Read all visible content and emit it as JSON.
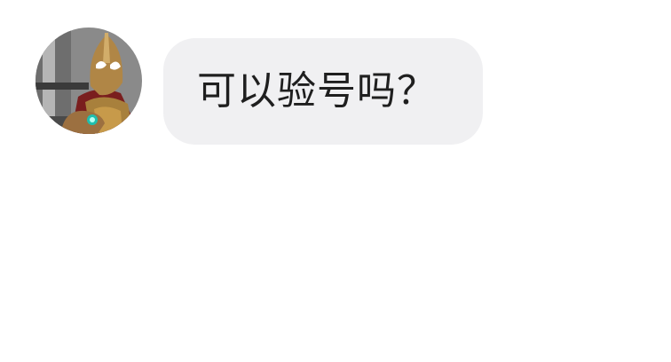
{
  "chat": {
    "messages": [
      {
        "sender_avatar_icon": "armored-hero-avatar-icon",
        "text": "可以验号吗？"
      }
    ]
  },
  "colors": {
    "page_background": "#ffffff",
    "bubble_background": "#f0f0f2",
    "message_text": "#1f1f1f"
  }
}
